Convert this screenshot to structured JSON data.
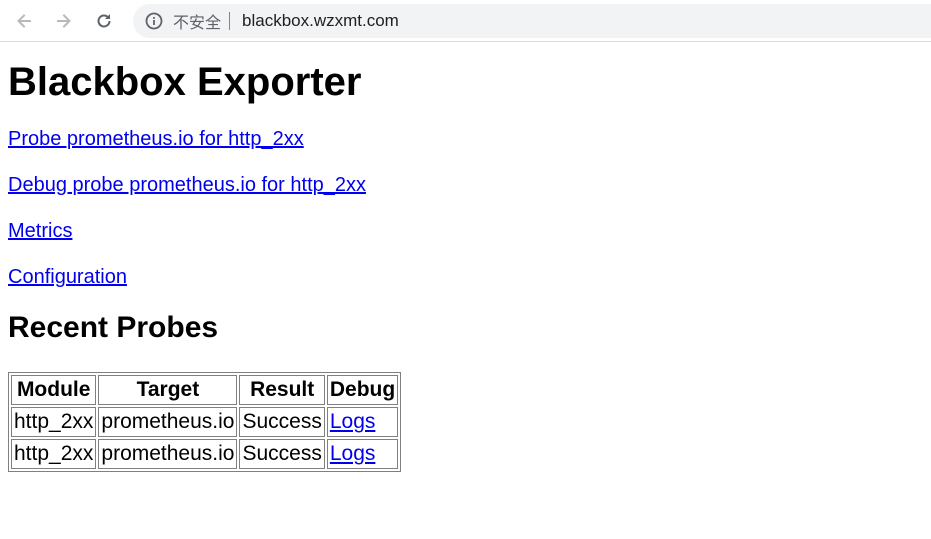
{
  "browser": {
    "security_label": "不安全",
    "url": "blackbox.wzxmt.com"
  },
  "page": {
    "title": "Blackbox Exporter",
    "links": [
      "Probe prometheus.io for http_2xx",
      "Debug probe prometheus.io for http_2xx",
      "Metrics",
      "Configuration"
    ],
    "recent_probes_heading": "Recent Probes",
    "table": {
      "headers": [
        "Module",
        "Target",
        "Result",
        "Debug"
      ],
      "rows": [
        {
          "module": "http_2xx",
          "target": "prometheus.io",
          "result": "Success",
          "debug": "Logs"
        },
        {
          "module": "http_2xx",
          "target": "prometheus.io",
          "result": "Success",
          "debug": "Logs"
        }
      ]
    }
  }
}
